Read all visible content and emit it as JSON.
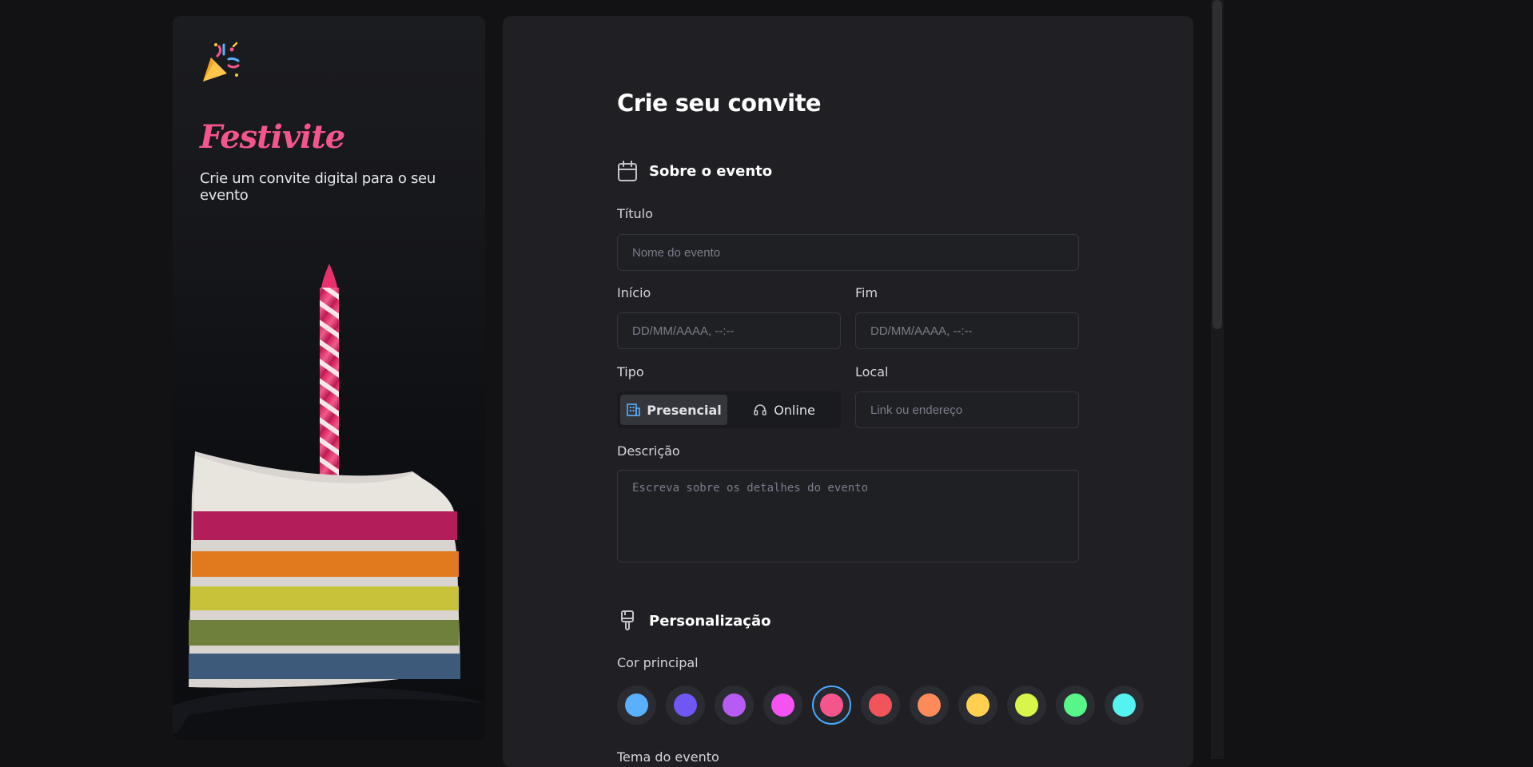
{
  "brand": {
    "name": "Festivite",
    "tagline": "Crie um convite digital para o seu evento"
  },
  "form": {
    "title": "Crie seu convite",
    "section_event": "Sobre o evento",
    "title_label": "Título",
    "title_placeholder": "Nome do evento",
    "start_label": "Início",
    "start_placeholder": "DD/MM/AAAA, --:--",
    "end_label": "Fim",
    "end_placeholder": "DD/MM/AAAA, --:--",
    "type_label": "Tipo",
    "type_options": [
      "Presencial",
      "Online"
    ],
    "type_selected": "Presencial",
    "location_label": "Local",
    "location_placeholder": "Link ou endereço",
    "description_label": "Descrição",
    "description_placeholder": "Escreva sobre os detalhes do evento",
    "section_custom": "Personalização",
    "color_label": "Cor principal",
    "colors": [
      "#5ab0ff",
      "#6f56f5",
      "#b65cf4",
      "#f552f2",
      "#f5558d",
      "#f2545b",
      "#fd8a5a",
      "#ffcf4f",
      "#d8f54a",
      "#57f58a",
      "#54f3f0"
    ],
    "color_selected": "#f5558d",
    "theme_label": "Tema do evento"
  }
}
